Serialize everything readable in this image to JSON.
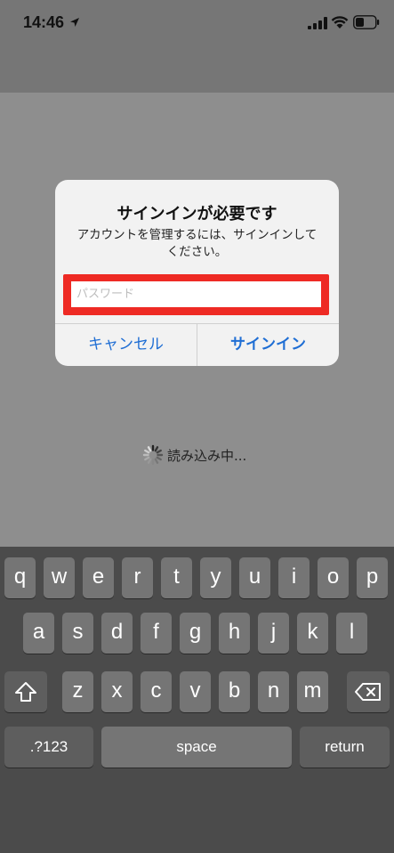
{
  "status_bar": {
    "time": "14:46"
  },
  "alert": {
    "title": "サインインが必要です",
    "message": "アカウントを管理するには、サインインしてください。",
    "password_placeholder": "パスワード",
    "cancel_label": "キャンセル",
    "signin_label": "サインイン",
    "highlight_color": "#ee2a24",
    "button_color": "#1f6ed4"
  },
  "loading": {
    "text": "読み込み中..."
  },
  "keyboard": {
    "row1": [
      "q",
      "w",
      "e",
      "r",
      "t",
      "y",
      "u",
      "i",
      "o",
      "p"
    ],
    "row2": [
      "a",
      "s",
      "d",
      "f",
      "g",
      "h",
      "j",
      "k",
      "l"
    ],
    "row3": [
      "z",
      "x",
      "c",
      "v",
      "b",
      "n",
      "m"
    ],
    "numbers_label": ".?123",
    "space_label": "space",
    "return_label": "return"
  }
}
